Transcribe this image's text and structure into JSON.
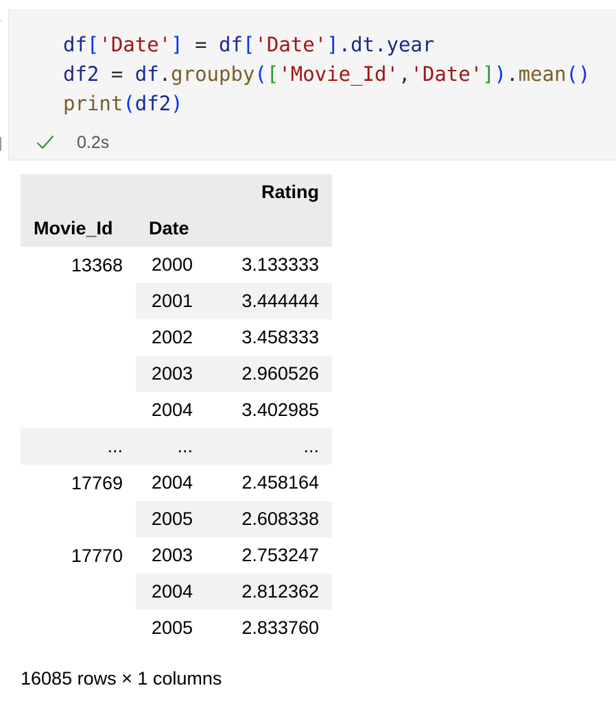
{
  "cell": {
    "code_lines": [
      [
        {
          "t": "df",
          "c": "var"
        },
        {
          "t": "[",
          "c": "br1"
        },
        {
          "t": "'Date'",
          "c": "str"
        },
        {
          "t": "]",
          "c": "br1"
        },
        {
          "t": " = ",
          "c": "op"
        },
        {
          "t": "df",
          "c": "var"
        },
        {
          "t": "[",
          "c": "br1"
        },
        {
          "t": "'Date'",
          "c": "str"
        },
        {
          "t": "]",
          "c": "br1"
        },
        {
          "t": ".dt.year",
          "c": "var"
        }
      ],
      [
        {
          "t": "df2",
          "c": "var"
        },
        {
          "t": " = ",
          "c": "op"
        },
        {
          "t": "df",
          "c": "var"
        },
        {
          "t": ".",
          "c": "op"
        },
        {
          "t": "groupby",
          "c": "fn"
        },
        {
          "t": "(",
          "c": "br1"
        },
        {
          "t": "[",
          "c": "br2"
        },
        {
          "t": "'Movie_Id'",
          "c": "str"
        },
        {
          "t": ",",
          "c": "op"
        },
        {
          "t": "'Date'",
          "c": "str"
        },
        {
          "t": "]",
          "c": "br2"
        },
        {
          "t": ")",
          "c": "br1"
        },
        {
          "t": ".",
          "c": "op"
        },
        {
          "t": "mean",
          "c": "fn"
        },
        {
          "t": "()",
          "c": "br1"
        }
      ],
      [
        {
          "t": "print",
          "c": "fn"
        },
        {
          "t": "(",
          "c": "br1"
        },
        {
          "t": "df2",
          "c": "var"
        },
        {
          "t": ")",
          "c": "br1"
        }
      ]
    ],
    "status": {
      "icon": "check-icon",
      "icon_color": "#3c8b3c",
      "exec_time": "0.2s"
    }
  },
  "output": {
    "column_header": "Rating",
    "index_names": [
      "Movie_Id",
      "Date"
    ],
    "rows": [
      {
        "movie_id": "13368",
        "date": "2000",
        "rating": "3.133333"
      },
      {
        "movie_id": "",
        "date": "2001",
        "rating": "3.444444"
      },
      {
        "movie_id": "",
        "date": "2002",
        "rating": "3.458333"
      },
      {
        "movie_id": "",
        "date": "2003",
        "rating": "2.960526"
      },
      {
        "movie_id": "",
        "date": "2004",
        "rating": "3.402985"
      },
      {
        "movie_id": "...",
        "date": "...",
        "rating": "..."
      },
      {
        "movie_id": "17769",
        "date": "2004",
        "rating": "2.458164"
      },
      {
        "movie_id": "",
        "date": "2005",
        "rating": "2.608338"
      },
      {
        "movie_id": "17770",
        "date": "2003",
        "rating": "2.753247"
      },
      {
        "movie_id": "",
        "date": "2004",
        "rating": "2.812362"
      },
      {
        "movie_id": "",
        "date": "2005",
        "rating": "2.833760"
      }
    ],
    "shape_text": "16085 rows × 1 columns"
  }
}
